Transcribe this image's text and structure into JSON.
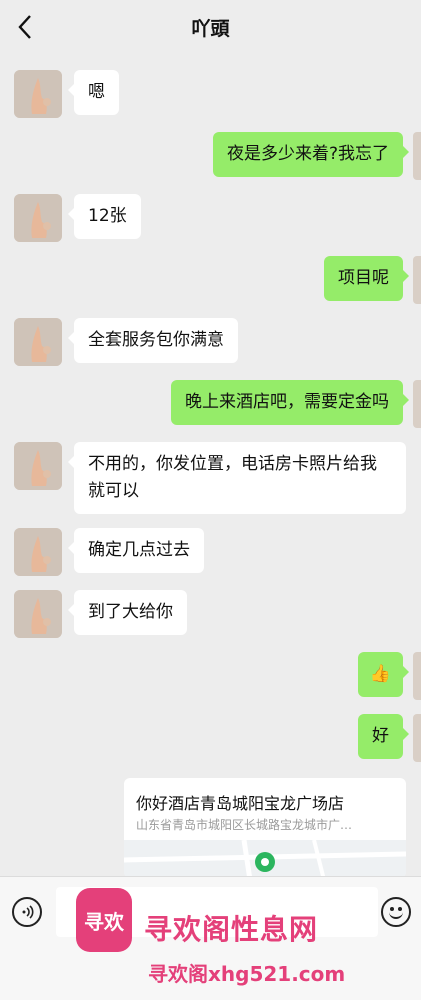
{
  "header": {
    "title": "吖頭",
    "back_icon": "back-chevron-icon"
  },
  "messages": [
    {
      "from": "them",
      "text": "嗯"
    },
    {
      "from": "me",
      "text": "夜是多少来着?我忘了"
    },
    {
      "from": "them",
      "text": "12张"
    },
    {
      "from": "me",
      "text": "项目呢"
    },
    {
      "from": "them",
      "text": "全套服务包你满意"
    },
    {
      "from": "me",
      "text": "晚上来酒店吧，需要定金吗"
    },
    {
      "from": "them",
      "text": "不用的，你发位置，电话房卡照片给我就可以"
    },
    {
      "from": "them",
      "text": "确定几点过去"
    },
    {
      "from": "them",
      "text": "到了大给你"
    },
    {
      "from": "me",
      "text": "👍"
    },
    {
      "from": "me",
      "text": "好"
    }
  ],
  "location_card": {
    "title": "你好酒店青岛城阳宝龙广场店",
    "address": "山东省青岛市城阳区长城路宝龙城市广…"
  },
  "input_bar": {
    "voice_icon": "voice-icon",
    "emoji_icon": "emoji-icon"
  },
  "watermark": {
    "logo_text": "寻欢",
    "site_name": "寻欢阁性息网",
    "url": "寻欢阁xhg521.com"
  },
  "colors": {
    "outgoing_bubble": "#95ec69",
    "background": "#ededed",
    "watermark": "#e4407a"
  }
}
